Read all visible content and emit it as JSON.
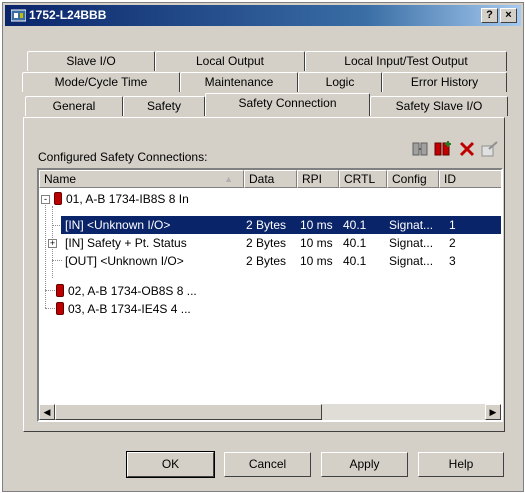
{
  "window": {
    "title": "1752-L24BBB",
    "help_button": "?",
    "close_button": "×"
  },
  "tabs": {
    "row1": [
      "Slave I/O",
      "Local Output",
      "Local Input/Test Output"
    ],
    "row2": [
      "Mode/Cycle Time",
      "Maintenance",
      "Logic",
      "Error History"
    ],
    "row3": [
      "General",
      "Safety",
      "Safety Connection",
      "Safety Slave I/O"
    ],
    "active": "Safety Connection"
  },
  "toolbar": {
    "icons": [
      "add-connection-icon",
      "add-module-connection-icon",
      "delete-icon",
      "properties-icon"
    ]
  },
  "list": {
    "label": "Configured Safety Connections:",
    "columns": [
      "Name",
      "Data",
      "RPI",
      "CRTL",
      "Config",
      "ID"
    ],
    "rows": [
      {
        "name": "01, A-B 1734-IB8S 8 In",
        "data": "",
        "rpi": "",
        "crtl": "",
        "config": "",
        "id": ""
      },
      {
        "name": "[IN] <Unknown I/O>",
        "data": "2 Bytes",
        "rpi": "10 ms",
        "crtl": "40.1",
        "config": "Signat...",
        "id": "1"
      },
      {
        "name": "[IN] Safety + Pt. Status",
        "data": "2 Bytes",
        "rpi": "10 ms",
        "crtl": "40.1",
        "config": "Signat...",
        "id": "2"
      },
      {
        "name": "[OUT] <Unknown I/O>",
        "data": "2 Bytes",
        "rpi": "10 ms",
        "crtl": "40.1",
        "config": "Signat...",
        "id": "3"
      },
      {
        "name": "02, A-B 1734-OB8S 8 ...",
        "data": "",
        "rpi": "",
        "crtl": "",
        "config": "",
        "id": ""
      },
      {
        "name": "03, A-B 1734-IE4S 4 ...",
        "data": "",
        "rpi": "",
        "crtl": "",
        "config": "",
        "id": ""
      }
    ]
  },
  "scrollbar": {
    "left_arrow": "◀",
    "right_arrow": "▶"
  },
  "buttons": {
    "ok": "OK",
    "cancel": "Cancel",
    "apply": "Apply",
    "help": "Help"
  },
  "colors": {
    "selection": "#0a246a",
    "titlebar": "#0a246a",
    "face": "#d4d0c8",
    "module_icon": "#bb0000"
  }
}
